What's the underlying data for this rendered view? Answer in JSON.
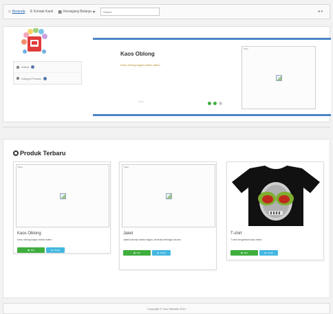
{
  "navbar": {
    "home_label": "Beranda",
    "item2_label": "Kontak Kami",
    "item3_label": "Keranjang Belanja",
    "search_placeholder": "Search",
    "right_label": "▾"
  },
  "sidebar": {
    "items": [
      {
        "label": "Artikel"
      },
      {
        "label": "Kategori Produk"
      }
    ]
  },
  "slider": {
    "title": "Kaos Oblong",
    "desc": "Kaos oblong bagus bahan adem",
    "button_label": "Detail",
    "image_tag": "Kaos"
  },
  "products": {
    "title": "Produk Terbaru",
    "items": [
      {
        "name": "Kaos Oblong",
        "desc": "Kaos oblong bagus bahan adem",
        "image_tag": "Kaos",
        "buy_label": "Beli",
        "detail_label": "Detail"
      },
      {
        "name": "Jaket",
        "desc": "Jaket kulit asli bahan bagus, tersedia berbagai ukuran",
        "image_tag": "Jaket",
        "buy_label": "Beli",
        "detail_label": "Detail"
      },
      {
        "name": "T-shirt",
        "desc": "T-shirt bergambar kaos hitam",
        "image_tag": "",
        "buy_label": "Beli",
        "detail_label": "Detail"
      }
    ]
  },
  "footer": {
    "text": "Copyright © Your Website 2014"
  },
  "colors": {
    "accent": "#4a84c4",
    "buy": "#3fae3f",
    "detail": "#44b7e0"
  }
}
